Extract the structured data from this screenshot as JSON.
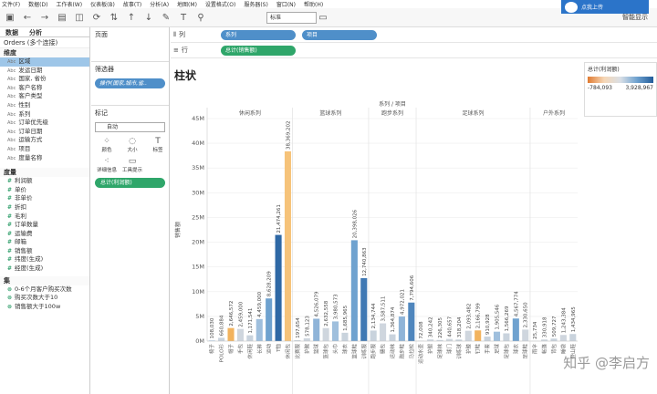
{
  "menu": [
    "文件(F)",
    "数据(D)",
    "工作表(W)",
    "仪表板(B)",
    "故事(T)",
    "分析(A)",
    "地图(M)",
    "设置格式(O)",
    "服务器(S)",
    "窗口(N)",
    "帮助(H)"
  ],
  "toolbar": {
    "select_value": "标准",
    "cloud_label": "点我上传",
    "smart_label": "智能显示"
  },
  "left": {
    "tabs": [
      "数据",
      "分析"
    ],
    "datasource": "Orders (多个连接)",
    "dims_header": "维度",
    "dimensions": [
      "区域",
      "发运日期",
      "国家, 省份",
      "客户名称",
      "客户类型",
      "性别",
      "系列",
      "订单优先级",
      "订单日期",
      "运输方式",
      "项目",
      "度量名称"
    ],
    "measures_header": "度量",
    "measures": [
      "利润额",
      "单价",
      "非单价",
      "折扣",
      "毛利",
      "订单数量",
      "运输费",
      "邮箱",
      "销售额",
      "纬度(生成)",
      "经度(生成)"
    ],
    "sets_header": "集",
    "sets": [
      "0-6个月客户购买次数",
      "购买次数大于10",
      "销售额大于100w"
    ]
  },
  "shelves": {
    "pages": "页面",
    "filters": "筛选器",
    "filter_pill": "操作(国家,城市,省..",
    "marks": "标记",
    "marks_type": "自动",
    "mark_cells": [
      "颜色",
      "大小",
      "标签",
      "详细信息",
      "工具提示"
    ],
    "marks_pill": "总计(利润额)"
  },
  "viz": {
    "col_label": "列",
    "row_label": "行",
    "col_pills": [
      "系列",
      "项目"
    ],
    "row_pill": "总计(销售额)",
    "title": "柱状",
    "legend_title": "总计(利润额)",
    "legend_min": "-784,093",
    "legend_max": "3,928,967"
  },
  "chart_data": {
    "type": "bar",
    "header": "系列 / 项目",
    "ylabel": "销售额",
    "ylim": [
      0,
      45000000
    ],
    "yticks": [
      "0M",
      "5M",
      "10M",
      "15M",
      "20M",
      "25M",
      "30M",
      "35M",
      "40M",
      "45M"
    ],
    "panels": [
      {
        "name": "休闲系列",
        "bars": [
          {
            "cat": "椅子",
            "value": 108030,
            "color": "#8fb4d8"
          },
          {
            "cat": "POLO衫",
            "value": 660884,
            "color": "#c9d3dd"
          },
          {
            "cat": "帽子",
            "value": 2646572,
            "color": "#f2b35e"
          },
          {
            "cat": "手包",
            "value": 2459000,
            "color": "#cfd6de"
          },
          {
            "cat": "休闲鞋",
            "value": 1171541,
            "color": "#c9d3dd"
          },
          {
            "cat": "长裤",
            "value": 4459000,
            "color": "#9fbfdd"
          },
          {
            "cat": "运动",
            "value": 8628209,
            "color": "#6fa2cf"
          },
          {
            "cat": "T恤",
            "value": 21474261,
            "color": "#2e68a5"
          },
          {
            "cat": "休闲包",
            "value": 38369202,
            "color": "#f6c37a"
          }
        ]
      },
      {
        "name": "篮球系列",
        "bars": [
          {
            "cat": "比赛服",
            "value": 197654,
            "color": "#c9d3dd"
          },
          {
            "cat": "护腕",
            "value": 578123,
            "color": "#cfd6de"
          },
          {
            "cat": "篮球",
            "value": 4526079,
            "color": "#8fb4d8"
          },
          {
            "cat": "篮球包",
            "value": 2632558,
            "color": "#cfd6de"
          },
          {
            "cat": "头巾",
            "value": 3980573,
            "color": "#9fbfdd"
          },
          {
            "cat": "球衣",
            "value": 1685965,
            "color": "#c9d3dd"
          },
          {
            "cat": "篮球鞋",
            "value": 20398026,
            "color": "#6fa2cf"
          },
          {
            "cat": "训练服",
            "value": 12740863,
            "color": "#3f78b3"
          }
        ]
      },
      {
        "name": "跑步系列",
        "bars": [
          {
            "cat": "跑步服",
            "value": 2134744,
            "color": "#c9d3dd"
          },
          {
            "cat": "腰包",
            "value": 3587511,
            "color": "#cfd6de"
          },
          {
            "cat": "运动袜",
            "value": 1364874,
            "color": "#c9d3dd"
          },
          {
            "cat": "跑步鞋",
            "value": 4972021,
            "color": "#8fb4d8"
          },
          {
            "cat": "马拉松",
            "value": 7794606,
            "color": "#4f86bd"
          }
        ]
      },
      {
        "name": "足球系列",
        "bars": [
          {
            "cat": "运动水壶",
            "value": 72008,
            "color": "#c9d3dd"
          },
          {
            "cat": "护腿",
            "value": 340242,
            "color": "#cfd6de"
          },
          {
            "cat": "足球袜",
            "value": 226305,
            "color": "#c9d3dd"
          },
          {
            "cat": "球门",
            "value": 440657,
            "color": "#cfd6de"
          },
          {
            "cat": "训练球",
            "value": 318204,
            "color": "#c9d3dd"
          },
          {
            "cat": "护膝",
            "value": 2093482,
            "color": "#cfd6de"
          },
          {
            "cat": "钉鞋",
            "value": 2166799,
            "color": "#f2b35e"
          },
          {
            "cat": "手套",
            "value": 910928,
            "color": "#c9d3dd"
          },
          {
            "cat": "足球",
            "value": 1905546,
            "color": "#9fbfdd"
          },
          {
            "cat": "足球包",
            "value": 1566269,
            "color": "#c9d3dd"
          },
          {
            "cat": "球衣",
            "value": 4567774,
            "color": "#6fa2cf"
          },
          {
            "cat": "足球鞋",
            "value": 2330650,
            "color": "#cfd6de"
          }
        ]
      },
      {
        "name": "户外系列",
        "bars": [
          {
            "cat": "雨伞",
            "value": 25734,
            "color": "#c9d3dd"
          },
          {
            "cat": "帐篷",
            "value": 330918,
            "color": "#cfd6de"
          },
          {
            "cat": "背包",
            "value": 509727,
            "color": "#c9d3dd"
          },
          {
            "cat": "睡袋",
            "value": 1243384,
            "color": "#cfd6de"
          },
          {
            "cat": "登山鞋",
            "value": 1434965,
            "color": "#c9d3dd"
          }
        ]
      }
    ]
  },
  "watermark": "知乎 @李启方"
}
